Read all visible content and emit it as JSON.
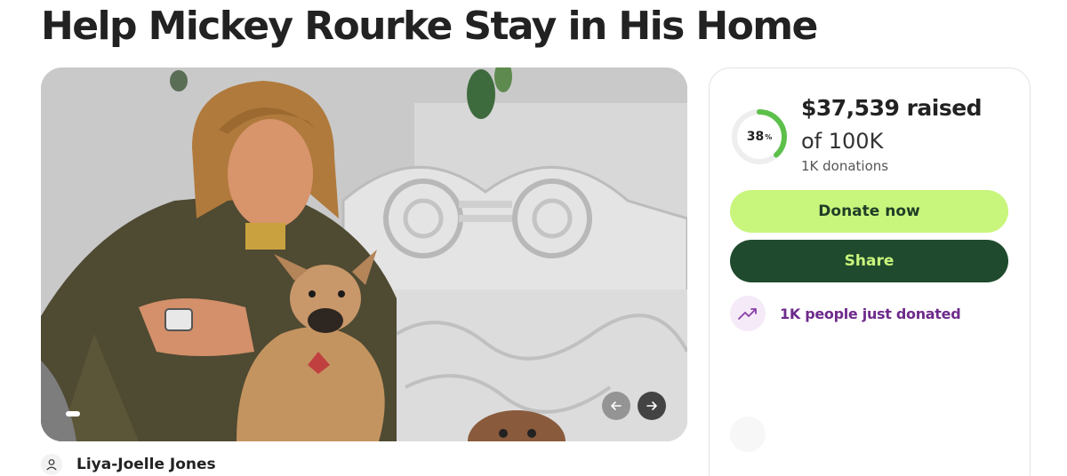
{
  "campaign": {
    "title": "Help Mickey Rourke Stay in His Home",
    "organizer": "Liya-Joelle Jones"
  },
  "media": {
    "image_description_icon": "campaign-photo",
    "prev_icon": "arrow-left-icon",
    "next_icon": "arrow-right-icon"
  },
  "donation_card": {
    "progress_percent": 38,
    "progress_percent_label": "38",
    "progress_percent_sign": "%",
    "raised_label": "$37,539 raised",
    "goal_label": "of 100K",
    "donations_label": "1K donations",
    "donate_button": "Donate now",
    "share_button": "Share",
    "trend_text": "1K people just donated"
  },
  "colors": {
    "accent_green": "#c8f57c",
    "dark_green": "#1f4a2e",
    "progress_green": "#5cc04a",
    "trend_purple": "#6e2b8c"
  }
}
